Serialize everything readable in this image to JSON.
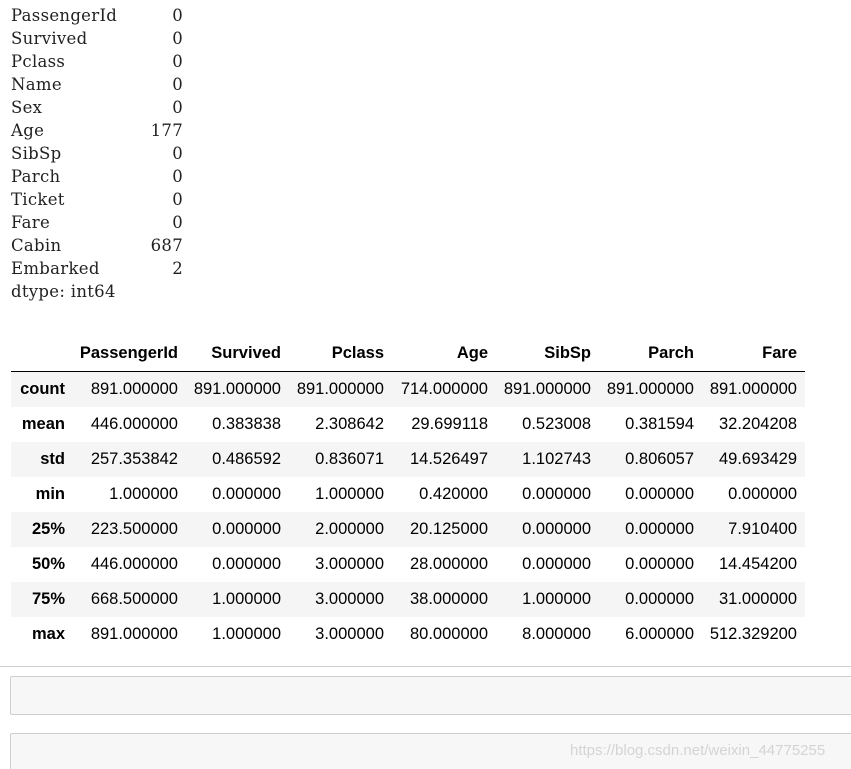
{
  "null_counts": {
    "rows": [
      {
        "key": "PassengerId",
        "value": "0"
      },
      {
        "key": "Survived",
        "value": "0"
      },
      {
        "key": "Pclass",
        "value": "0"
      },
      {
        "key": "Name",
        "value": "0"
      },
      {
        "key": "Sex",
        "value": "0"
      },
      {
        "key": "Age",
        "value": "177"
      },
      {
        "key": "SibSp",
        "value": "0"
      },
      {
        "key": "Parch",
        "value": "0"
      },
      {
        "key": "Ticket",
        "value": "0"
      },
      {
        "key": "Fare",
        "value": "0"
      },
      {
        "key": "Cabin",
        "value": "687"
      },
      {
        "key": "Embarked",
        "value": "2"
      }
    ],
    "dtype": "dtype: int64"
  },
  "describe": {
    "columns": [
      "",
      "PassengerId",
      "Survived",
      "Pclass",
      "Age",
      "SibSp",
      "Parch",
      "Fare"
    ],
    "rows": [
      {
        "index": "count",
        "values": [
          "891.000000",
          "891.000000",
          "891.000000",
          "714.000000",
          "891.000000",
          "891.000000",
          "891.000000"
        ]
      },
      {
        "index": "mean",
        "values": [
          "446.000000",
          "0.383838",
          "2.308642",
          "29.699118",
          "0.523008",
          "0.381594",
          "32.204208"
        ]
      },
      {
        "index": "std",
        "values": [
          "257.353842",
          "0.486592",
          "0.836071",
          "14.526497",
          "1.102743",
          "0.806057",
          "49.693429"
        ]
      },
      {
        "index": "min",
        "values": [
          "1.000000",
          "0.000000",
          "1.000000",
          "0.420000",
          "0.000000",
          "0.000000",
          "0.000000"
        ]
      },
      {
        "index": "25%",
        "values": [
          "223.500000",
          "0.000000",
          "2.000000",
          "20.125000",
          "0.000000",
          "0.000000",
          "7.910400"
        ]
      },
      {
        "index": "50%",
        "values": [
          "446.000000",
          "0.000000",
          "3.000000",
          "28.000000",
          "0.000000",
          "0.000000",
          "14.454200"
        ]
      },
      {
        "index": "75%",
        "values": [
          "668.500000",
          "1.000000",
          "3.000000",
          "38.000000",
          "1.000000",
          "0.000000",
          "31.000000"
        ]
      },
      {
        "index": "max",
        "values": [
          "891.000000",
          "1.000000",
          "3.000000",
          "80.000000",
          "8.000000",
          "6.000000",
          "512.329200"
        ]
      }
    ]
  },
  "watermark": "https://blog.csdn.net/weixin_44775255"
}
